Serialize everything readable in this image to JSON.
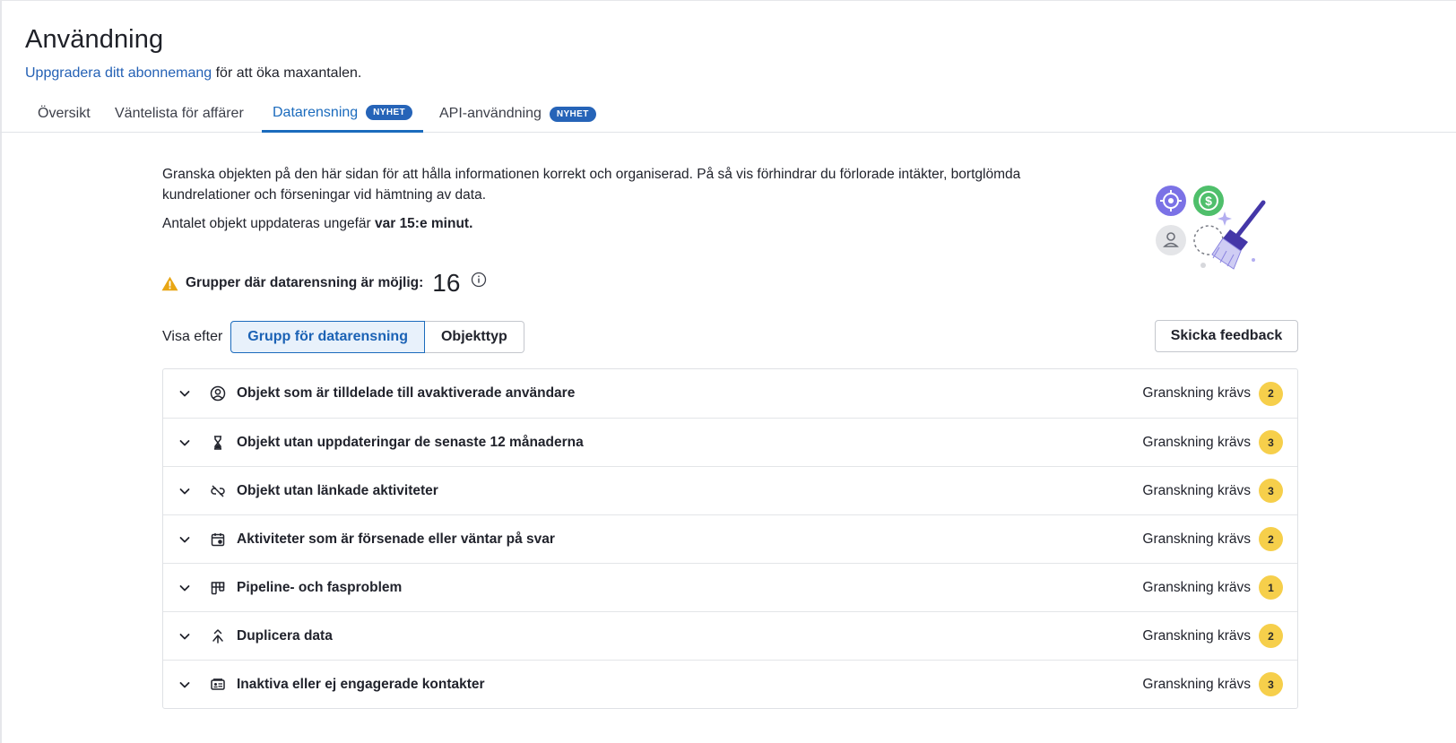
{
  "header": {
    "title": "Användning",
    "upgrade_link": "Uppgradera ditt abonnemang",
    "upgrade_suffix": " för att öka maxantalen."
  },
  "tabs": [
    {
      "label": "Översikt",
      "active": false,
      "badge": ""
    },
    {
      "label": "Väntelista för affärer",
      "active": false,
      "badge": ""
    },
    {
      "label": "Datarensning",
      "active": true,
      "badge": "NYHET"
    },
    {
      "label": "API-användning",
      "active": false,
      "badge": "NYHET"
    }
  ],
  "intro": {
    "text": "Granska objekten på den här sidan för att hålla informationen korrekt och organiserad. På så vis förhindrar du förlorade intäkter, bortglömda kundrelationer och förseningar vid hämtning av data.",
    "update_prefix": "Antalet objekt uppdateras ungefär ",
    "update_bold": "var 15:e minut."
  },
  "groups": {
    "label": "Grupper där datarensning är möjlig:",
    "count": "16"
  },
  "view_by": {
    "label": "Visa efter",
    "options": [
      "Grupp för datarensning",
      "Objekttyp"
    ],
    "selected": "Grupp för datarensning"
  },
  "feedback_button": "Skicka feedback",
  "rows": [
    {
      "label": "Objekt som är tilldelade till avaktiverade användare",
      "icon": "user-circle-icon",
      "status": "Granskning krävs",
      "count": "2"
    },
    {
      "label": "Objekt utan uppdateringar de senaste 12 månaderna",
      "icon": "hourglass-icon",
      "status": "Granskning krävs",
      "count": "3"
    },
    {
      "label": "Objekt utan länkade aktiviteter",
      "icon": "unlink-icon",
      "status": "Granskning krävs",
      "count": "3"
    },
    {
      "label": "Aktiviteter som är försenade eller väntar på svar",
      "icon": "calendar-clock-icon",
      "status": "Granskning krävs",
      "count": "2"
    },
    {
      "label": "Pipeline- och fasproblem",
      "icon": "pipeline-icon",
      "status": "Granskning krävs",
      "count": "1"
    },
    {
      "label": "Duplicera data",
      "icon": "merge-icon",
      "status": "Granskning krävs",
      "count": "2"
    },
    {
      "label": "Inaktiva eller ej engagerade kontakter",
      "icon": "contact-card-icon",
      "status": "Granskning krävs",
      "count": "3"
    }
  ],
  "colors": {
    "link": "#2461b5",
    "active_tab": "#1b6bbd",
    "badge_new": "#2664b8",
    "count_badge": "#f6cf4b",
    "warning": "#e8a614"
  }
}
